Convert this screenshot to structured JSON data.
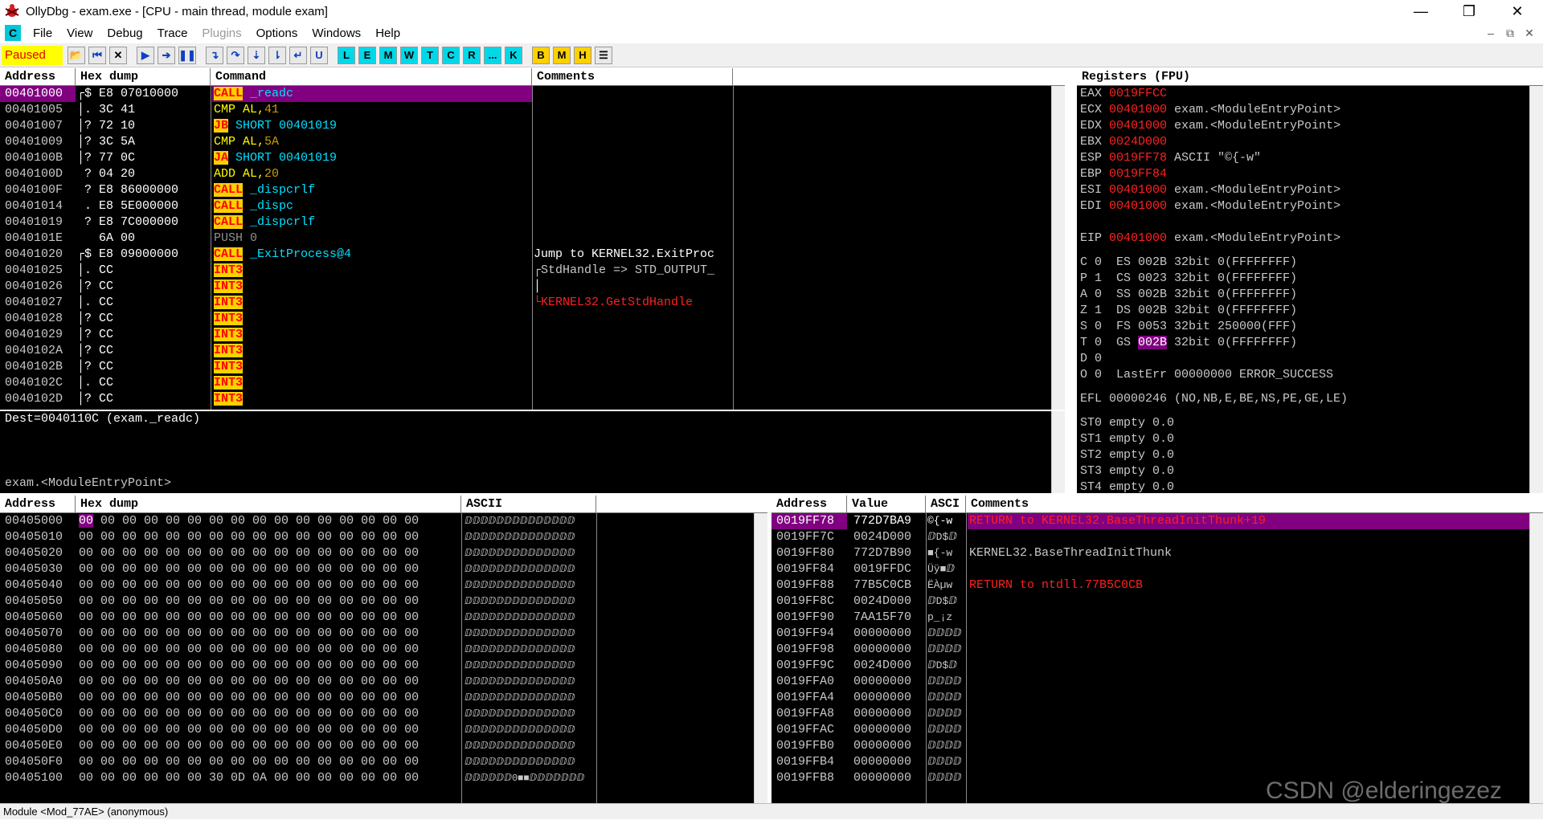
{
  "window": {
    "title": "OllyDbg - exam.exe - [CPU - main thread, module exam]",
    "min": "—",
    "max": "❐",
    "close": "✕"
  },
  "menu": [
    "File",
    "View",
    "Debug",
    "Trace",
    "Plugins",
    "Options",
    "Windows",
    "Help"
  ],
  "menu_icon": "C",
  "mdi_controls": [
    "–",
    "⧉",
    "✕"
  ],
  "toolbar": {
    "status": "Paused",
    "buttons": [
      "L",
      "E",
      "M",
      "W",
      "T",
      "C",
      "R",
      "...",
      "K",
      "B",
      "M",
      "H"
    ]
  },
  "disasm": {
    "headers": [
      "Address",
      "Hex dump",
      "Command",
      "Comments"
    ],
    "rows": [
      {
        "addr": "00401000",
        "mark": "┌$",
        "hex": "E8 07010000",
        "op": "CALL",
        "arg": "_readc",
        "argc": "tgt",
        "comment": "",
        "sel": true
      },
      {
        "addr": "00401005",
        "mark": "│.",
        "hex": "3C 41",
        "op": "CMP",
        "arg": "AL,41",
        "argc": "cmp",
        "comment": ""
      },
      {
        "addr": "00401007",
        "mark": "│?",
        "hex": "72 10",
        "op": "JB",
        "arg": "SHORT 00401019",
        "argc": "tgt",
        "comment": ""
      },
      {
        "addr": "00401009",
        "mark": "│?",
        "hex": "3C 5A",
        "op": "CMP",
        "arg": "AL,5A",
        "argc": "cmp",
        "comment": ""
      },
      {
        "addr": "0040100B",
        "mark": "│?",
        "hex": "77 0C",
        "op": "JA",
        "arg": "SHORT 00401019",
        "argc": "tgt",
        "comment": ""
      },
      {
        "addr": "0040100D",
        "mark": " ?",
        "hex": "04 20",
        "op": "ADD",
        "arg": "AL,20",
        "argc": "cmp",
        "comment": ""
      },
      {
        "addr": "0040100F",
        "mark": " ?",
        "hex": "E8 86000000",
        "op": "CALL",
        "arg": "_dispcrlf",
        "argc": "tgt",
        "comment": ""
      },
      {
        "addr": "00401014",
        "mark": " .",
        "hex": "E8 5E000000",
        "op": "CALL",
        "arg": "_dispc",
        "argc": "tgt",
        "comment": ""
      },
      {
        "addr": "00401019",
        "mark": " ?",
        "hex": "E8 7C000000",
        "op": "CALL",
        "arg": "_dispcrlf",
        "argc": "tgt",
        "comment": ""
      },
      {
        "addr": "0040101E",
        "mark": "  ",
        "hex": "6A 00",
        "op": "PUSH",
        "arg": "0",
        "argc": "push",
        "comment": ""
      },
      {
        "addr": "00401020",
        "mark": "┌$",
        "hex": "E8 09000000",
        "op": "CALL",
        "arg": "_ExitProcess@4",
        "argc": "tgt",
        "comment": "Jump to KERNEL32.ExitProc"
      },
      {
        "addr": "00401025",
        "mark": "│.",
        "hex": "CC",
        "op": "INT3",
        "arg": "",
        "argc": "",
        "comment": "┌StdHandle => STD_OUTPUT_"
      },
      {
        "addr": "00401026",
        "mark": "│?",
        "hex": "CC",
        "op": "INT3",
        "arg": "",
        "argc": "",
        "comment": "│"
      },
      {
        "addr": "00401027",
        "mark": "│.",
        "hex": "CC",
        "op": "INT3",
        "arg": "",
        "argc": "",
        "comment": "└KERNEL32.GetStdHandle"
      },
      {
        "addr": "00401028",
        "mark": "│?",
        "hex": "CC",
        "op": "INT3",
        "arg": "",
        "argc": "",
        "comment": ""
      },
      {
        "addr": "00401029",
        "mark": "│?",
        "hex": "CC",
        "op": "INT3",
        "arg": "",
        "argc": "",
        "comment": ""
      },
      {
        "addr": "0040102A",
        "mark": "│?",
        "hex": "CC",
        "op": "INT3",
        "arg": "",
        "argc": "",
        "comment": ""
      },
      {
        "addr": "0040102B",
        "mark": "│?",
        "hex": "CC",
        "op": "INT3",
        "arg": "",
        "argc": "",
        "comment": ""
      },
      {
        "addr": "0040102C",
        "mark": "│.",
        "hex": "CC",
        "op": "INT3",
        "arg": "",
        "argc": "",
        "comment": ""
      },
      {
        "addr": "0040102D",
        "mark": "│?",
        "hex": "CC",
        "op": "INT3",
        "arg": "",
        "argc": "",
        "comment": ""
      }
    ]
  },
  "info": {
    "line1": "Dest=0040110C (exam._readc)",
    "line2": "exam.<ModuleEntryPoint>"
  },
  "registers": {
    "header": "Registers (FPU)",
    "rows": [
      {
        "n": "EAX",
        "v": "0019FFCC",
        "d": ""
      },
      {
        "n": "ECX",
        "v": "00401000",
        "d": "exam.<ModuleEntryPoint>"
      },
      {
        "n": "EDX",
        "v": "00401000",
        "d": "exam.<ModuleEntryPoint>"
      },
      {
        "n": "EBX",
        "v": "0024D000",
        "d": ""
      },
      {
        "n": "ESP",
        "v": "0019FF78",
        "d": "ASCII \"©{-w\""
      },
      {
        "n": "EBP",
        "v": "0019FF84",
        "d": ""
      },
      {
        "n": "ESI",
        "v": "00401000",
        "d": "exam.<ModuleEntryPoint>"
      },
      {
        "n": "EDI",
        "v": "00401000",
        "d": "exam.<ModuleEntryPoint>"
      },
      {
        "n": "",
        "v": "",
        "d": ""
      },
      {
        "n": "EIP",
        "v": "00401000",
        "d": "exam.<ModuleEntryPoint>"
      }
    ],
    "flags": [
      "C 0  ES 002B 32bit 0(FFFFFFFF)",
      "P 1  CS 0023 32bit 0(FFFFFFFF)",
      "A 0  SS 002B 32bit 0(FFFFFFFF)",
      "Z 1  DS 002B 32bit 0(FFFFFFFF)",
      "S 0  FS 0053 32bit 250000(FFF)",
      "T 0  GS 002B 32bit 0(FFFFFFFF)",
      "D 0",
      "O 0  LastErr 00000000 ERROR_SUCCESS"
    ],
    "efl": "EFL 00000246 (NO,NB,E,BE,NS,PE,GE,LE)",
    "fpu": [
      "ST0 empty 0.0",
      "ST1 empty 0.0",
      "ST2 empty 0.0",
      "ST3 empty 0.0",
      "ST4 empty 0.0"
    ]
  },
  "dump": {
    "headers": [
      "Address",
      "Hex dump",
      "ASCII"
    ],
    "rows": [
      {
        "addr": "00405000",
        "hex": "00 00 00 00 00 00 00 00 00 00 00 00 00 00 00 00",
        "ascii": "ⅅⅅⅅⅅⅅⅅⅅⅅⅅⅅⅅⅅⅅⅅ"
      },
      {
        "addr": "00405010",
        "hex": "00 00 00 00 00 00 00 00 00 00 00 00 00 00 00 00",
        "ascii": "ⅅⅅⅅⅅⅅⅅⅅⅅⅅⅅⅅⅅⅅⅅ"
      },
      {
        "addr": "00405020",
        "hex": "00 00 00 00 00 00 00 00 00 00 00 00 00 00 00 00",
        "ascii": "ⅅⅅⅅⅅⅅⅅⅅⅅⅅⅅⅅⅅⅅⅅ"
      },
      {
        "addr": "00405030",
        "hex": "00 00 00 00 00 00 00 00 00 00 00 00 00 00 00 00",
        "ascii": "ⅅⅅⅅⅅⅅⅅⅅⅅⅅⅅⅅⅅⅅⅅ"
      },
      {
        "addr": "00405040",
        "hex": "00 00 00 00 00 00 00 00 00 00 00 00 00 00 00 00",
        "ascii": "ⅅⅅⅅⅅⅅⅅⅅⅅⅅⅅⅅⅅⅅⅅ"
      },
      {
        "addr": "00405050",
        "hex": "00 00 00 00 00 00 00 00 00 00 00 00 00 00 00 00",
        "ascii": "ⅅⅅⅅⅅⅅⅅⅅⅅⅅⅅⅅⅅⅅⅅ"
      },
      {
        "addr": "00405060",
        "hex": "00 00 00 00 00 00 00 00 00 00 00 00 00 00 00 00",
        "ascii": "ⅅⅅⅅⅅⅅⅅⅅⅅⅅⅅⅅⅅⅅⅅ"
      },
      {
        "addr": "00405070",
        "hex": "00 00 00 00 00 00 00 00 00 00 00 00 00 00 00 00",
        "ascii": "ⅅⅅⅅⅅⅅⅅⅅⅅⅅⅅⅅⅅⅅⅅ"
      },
      {
        "addr": "00405080",
        "hex": "00 00 00 00 00 00 00 00 00 00 00 00 00 00 00 00",
        "ascii": "ⅅⅅⅅⅅⅅⅅⅅⅅⅅⅅⅅⅅⅅⅅ"
      },
      {
        "addr": "00405090",
        "hex": "00 00 00 00 00 00 00 00 00 00 00 00 00 00 00 00",
        "ascii": "ⅅⅅⅅⅅⅅⅅⅅⅅⅅⅅⅅⅅⅅⅅ"
      },
      {
        "addr": "004050A0",
        "hex": "00 00 00 00 00 00 00 00 00 00 00 00 00 00 00 00",
        "ascii": "ⅅⅅⅅⅅⅅⅅⅅⅅⅅⅅⅅⅅⅅⅅ"
      },
      {
        "addr": "004050B0",
        "hex": "00 00 00 00 00 00 00 00 00 00 00 00 00 00 00 00",
        "ascii": "ⅅⅅⅅⅅⅅⅅⅅⅅⅅⅅⅅⅅⅅⅅ"
      },
      {
        "addr": "004050C0",
        "hex": "00 00 00 00 00 00 00 00 00 00 00 00 00 00 00 00",
        "ascii": "ⅅⅅⅅⅅⅅⅅⅅⅅⅅⅅⅅⅅⅅⅅ"
      },
      {
        "addr": "004050D0",
        "hex": "00 00 00 00 00 00 00 00 00 00 00 00 00 00 00 00",
        "ascii": "ⅅⅅⅅⅅⅅⅅⅅⅅⅅⅅⅅⅅⅅⅅ"
      },
      {
        "addr": "004050E0",
        "hex": "00 00 00 00 00 00 00 00 00 00 00 00 00 00 00 00",
        "ascii": "ⅅⅅⅅⅅⅅⅅⅅⅅⅅⅅⅅⅅⅅⅅ"
      },
      {
        "addr": "004050F0",
        "hex": "00 00 00 00 00 00 00 00 00 00 00 00 00 00 00 00",
        "ascii": "ⅅⅅⅅⅅⅅⅅⅅⅅⅅⅅⅅⅅⅅⅅ"
      },
      {
        "addr": "00405100",
        "hex": "00 00 00 00 00 00 30 0D 0A 00 00 00 00 00 00 00",
        "ascii": "ⅅⅅⅅⅅⅅⅅ0■■ⅅⅅⅅⅅⅅⅅⅅ"
      }
    ]
  },
  "stack": {
    "headers": [
      "Address",
      "Value",
      "ASCI",
      "Comments"
    ],
    "rows": [
      {
        "addr": "0019FF78",
        "val": "772D7BA9",
        "asc": "©{-w",
        "cmt": "RETURN to KERNEL32.BaseThreadInitThunk+19",
        "sel": true,
        "red": true
      },
      {
        "addr": "0019FF7C",
        "val": "0024D000",
        "asc": "ⅅD$ⅅ",
        "cmt": ""
      },
      {
        "addr": "0019FF80",
        "val": "772D7B90",
        "asc": "■{-w",
        "cmt": "KERNEL32.BaseThreadInitThunk"
      },
      {
        "addr": "0019FF84",
        "val": "0019FFDC",
        "asc": "Üÿ■ⅅ",
        "cmt": ""
      },
      {
        "addr": "0019FF88",
        "val": "77B5C0CB",
        "asc": "ËÀµw",
        "cmt": "RETURN to ntdll.77B5C0CB",
        "red": true
      },
      {
        "addr": "0019FF8C",
        "val": "0024D000",
        "asc": "ⅅD$ⅅ",
        "cmt": ""
      },
      {
        "addr": "0019FF90",
        "val": "7AA15F70",
        "asc": "p_¡z",
        "cmt": ""
      },
      {
        "addr": "0019FF94",
        "val": "00000000",
        "asc": "ⅅⅅⅅⅅ",
        "cmt": ""
      },
      {
        "addr": "0019FF98",
        "val": "00000000",
        "asc": "ⅅⅅⅅⅅ",
        "cmt": ""
      },
      {
        "addr": "0019FF9C",
        "val": "0024D000",
        "asc": "ⅅD$ⅅ",
        "cmt": ""
      },
      {
        "addr": "0019FFA0",
        "val": "00000000",
        "asc": "ⅅⅅⅅⅅ",
        "cmt": ""
      },
      {
        "addr": "0019FFA4",
        "val": "00000000",
        "asc": "ⅅⅅⅅⅅ",
        "cmt": ""
      },
      {
        "addr": "0019FFA8",
        "val": "00000000",
        "asc": "ⅅⅅⅅⅅ",
        "cmt": ""
      },
      {
        "addr": "0019FFAC",
        "val": "00000000",
        "asc": "ⅅⅅⅅⅅ",
        "cmt": ""
      },
      {
        "addr": "0019FFB0",
        "val": "00000000",
        "asc": "ⅅⅅⅅⅅ",
        "cmt": ""
      },
      {
        "addr": "0019FFB4",
        "val": "00000000",
        "asc": "ⅅⅅⅅⅅ",
        "cmt": ""
      },
      {
        "addr": "0019FFB8",
        "val": "00000000",
        "asc": "ⅅⅅⅅⅅ",
        "cmt": ""
      }
    ]
  },
  "statusbar": "Module <Mod_77AE> (anonymous)",
  "watermark": "CSDN @elderingezez"
}
